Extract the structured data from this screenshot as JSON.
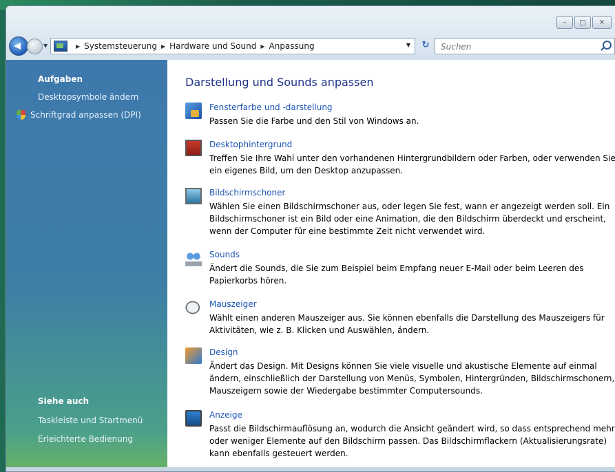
{
  "window": {
    "controls": {
      "minimize": "–",
      "maximize": "□",
      "close": "✕"
    }
  },
  "navbar": {
    "breadcrumbs": [
      "Systemsteuerung",
      "Hardware und Sound",
      "Anpassung"
    ],
    "search_placeholder": "Suchen"
  },
  "sidebar": {
    "tasks_heading": "Aufgaben",
    "tasks": [
      "Desktopsymbole ändern",
      "Schriftgrad anpassen (DPI)"
    ],
    "see_also_heading": "Siehe auch",
    "see_also": [
      "Taskleiste und Startmenü",
      "Erleichterte Bedienung"
    ]
  },
  "main": {
    "title": "Darstellung und Sounds anpassen",
    "items": [
      {
        "icon": "window-color-icon",
        "label": "Fensterfarbe und -darstellung",
        "desc": "Passen Sie die Farbe und den Stil von Windows an."
      },
      {
        "icon": "desktop-background-icon",
        "label": "Desktophintergrund",
        "desc": "Treffen Sie Ihre Wahl unter den vorhandenen Hintergrundbildern oder Farben, oder verwenden Sie ein eigenes Bild, um den Desktop anzupassen."
      },
      {
        "icon": "screensaver-icon",
        "label": "Bildschirmschoner",
        "desc": "Wählen Sie einen Bildschirmschoner aus, oder legen Sie fest, wann er angezeigt werden soll. Ein Bildschirmschoner ist ein Bild oder eine Animation, die den Bildschirm überdeckt und erscheint, wenn der Computer für eine bestimmte Zeit nicht verwendet wird."
      },
      {
        "icon": "sounds-icon",
        "label": "Sounds",
        "desc": "Ändert die Sounds, die Sie zum Beispiel beim Empfang neuer E-Mail oder beim Leeren des Papierkorbs hören."
      },
      {
        "icon": "mouse-pointer-icon",
        "label": "Mauszeiger",
        "desc": "Wählt einen anderen Mauszeiger aus. Sie können ebenfalls die Darstellung des Mauszeigers für Aktivitäten, wie z. B. Klicken und Auswählen, ändern."
      },
      {
        "icon": "design-icon",
        "label": "Design",
        "desc": "Ändert das Design. Mit Designs können Sie viele visuelle und akustische Elemente auf einmal ändern, einschließlich der Darstellung von Menüs, Symbolen, Hintergründen, Bildschirmschonern, Mauszeigern sowie der Wiedergabe bestimmter Computersounds."
      },
      {
        "icon": "display-icon",
        "label": "Anzeige",
        "desc": "Passt die Bildschirmauflösung an, wodurch die Ansicht geändert wird, so dass entsprechend mehr oder weniger Elemente auf den Bildschirm passen. Das Bildschirmflackern (Aktualisierungsrate) kann ebenfalls gesteuert werden."
      }
    ]
  }
}
